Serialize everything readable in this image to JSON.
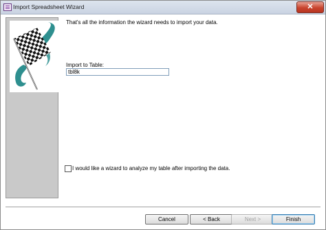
{
  "window": {
    "title": "Import Spreadsheet Wizard",
    "close_glyph": "✕"
  },
  "main": {
    "message": "That's all the information the wizard needs to import your data.",
    "import_label": "Import to Table:",
    "import_value": "tbl8k",
    "analyze_checkbox_label": "I would like a wizard to analyze my table after importing the data.",
    "analyze_checked": false
  },
  "buttons": {
    "cancel": "Cancel",
    "back": "< Back",
    "next": "Next >",
    "finish": "Finish"
  },
  "icons": {
    "app_icon": "access-form-icon",
    "side_image": "checkered-flag-icon"
  },
  "colors": {
    "side_panel": "#c9c9c9",
    "flag_swirl": "#2e8f8f",
    "close_button": "#c9452f"
  }
}
